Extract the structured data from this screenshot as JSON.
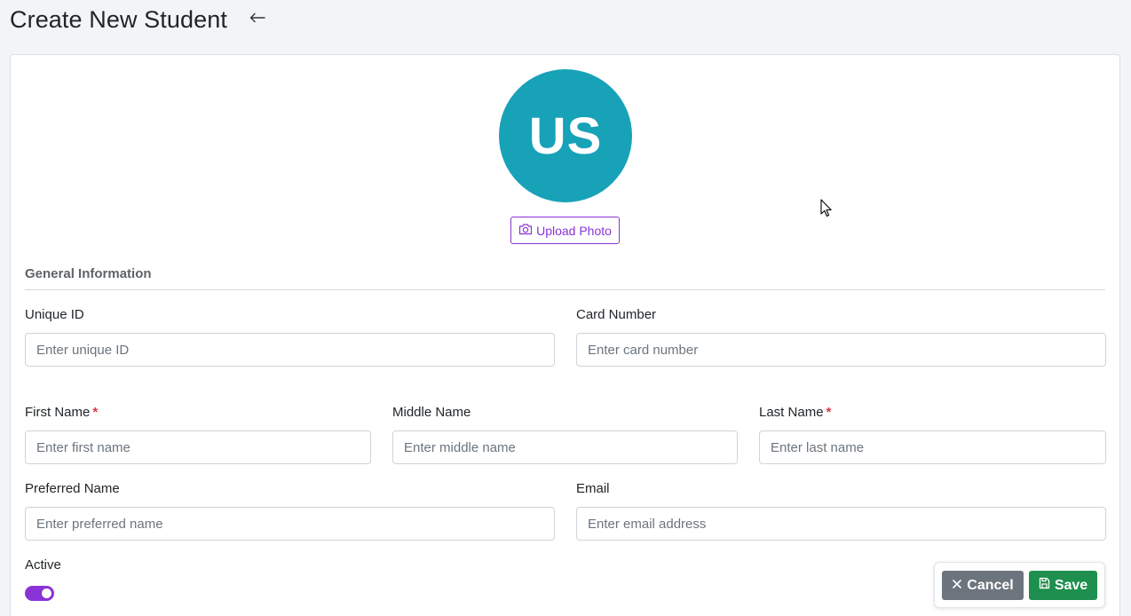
{
  "header": {
    "title": "Create New Student",
    "back_icon": "arrow-left-icon"
  },
  "avatar": {
    "initials": "US",
    "color": "#17a2b8"
  },
  "upload": {
    "label": "Upload Photo",
    "icon": "camera-icon",
    "color": "#8a33d6"
  },
  "section": {
    "title": "General Information"
  },
  "fields": {
    "unique_id": {
      "label": "Unique ID",
      "placeholder": "Enter unique ID",
      "value": ""
    },
    "card_number": {
      "label": "Card Number",
      "placeholder": "Enter card number",
      "value": ""
    },
    "first_name": {
      "label": "First Name",
      "required_mark": "*",
      "placeholder": "Enter first name",
      "value": ""
    },
    "middle_name": {
      "label": "Middle Name",
      "placeholder": "Enter middle name",
      "value": ""
    },
    "last_name": {
      "label": "Last Name",
      "required_mark": "*",
      "placeholder": "Enter last name",
      "value": ""
    },
    "preferred_name": {
      "label": "Preferred Name",
      "placeholder": "Enter preferred name",
      "value": ""
    },
    "email": {
      "label": "Email",
      "placeholder": "Enter email address",
      "value": ""
    }
  },
  "active": {
    "label": "Active",
    "checked": true,
    "color": "#8a33d6"
  },
  "actions": {
    "cancel_label": "Cancel",
    "cancel_icon": "close-icon",
    "cancel_color": "#6c757d",
    "save_label": "Save",
    "save_icon": "save-icon",
    "save_color": "#1e8f4e"
  }
}
